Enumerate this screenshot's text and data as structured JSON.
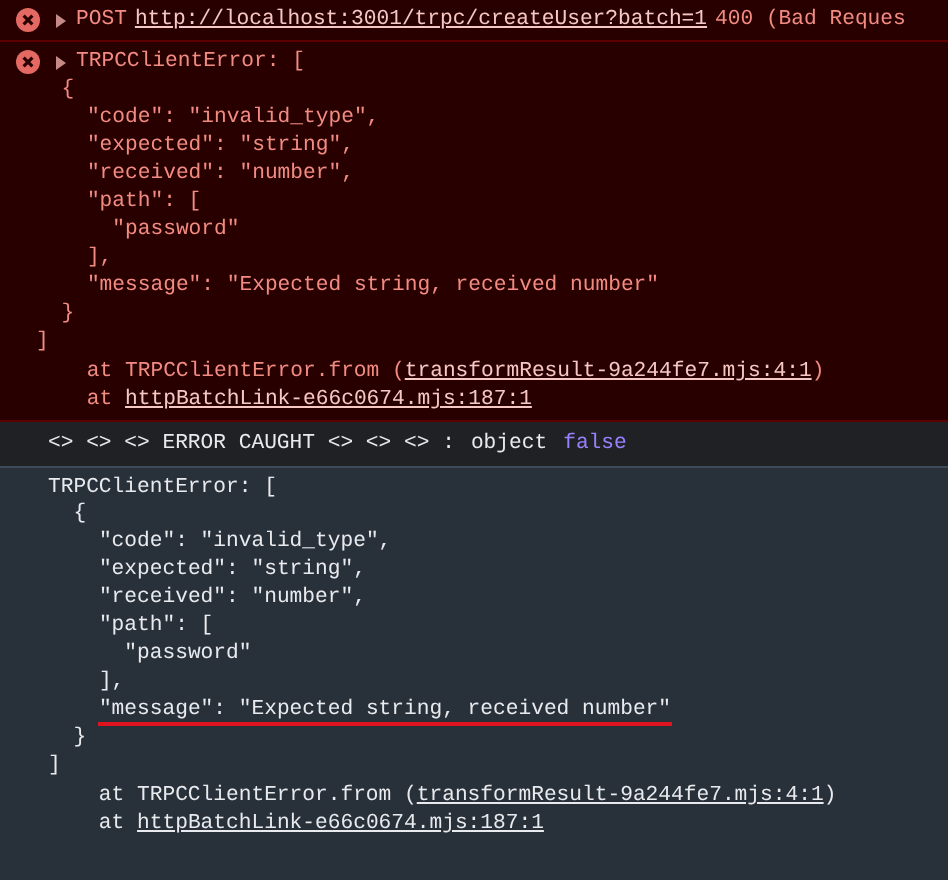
{
  "entries": [
    {
      "kind": "error",
      "expanded": false,
      "method": "POST",
      "url": "http://localhost:3001/trpc/createUser?batch=1",
      "status": "400 (Bad Reques"
    },
    {
      "kind": "error",
      "expanded": false,
      "title": "TRPCClientError: [",
      "lines": [
        {
          "text": "  {",
          "highlighted": false
        },
        {
          "text": "    \"code\": \"invalid_type\",",
          "highlighted": false
        },
        {
          "text": "    \"expected\": \"string\",",
          "highlighted": false
        },
        {
          "text": "    \"received\": \"number\",",
          "highlighted": false
        },
        {
          "text": "    \"path\": [",
          "highlighted": false
        },
        {
          "text": "      \"password\"",
          "highlighted": false
        },
        {
          "text": "    ],",
          "highlighted": false
        },
        {
          "text": "    \"message\": \"Expected string, received number\"",
          "highlighted": false
        },
        {
          "text": "  }",
          "highlighted": false
        },
        {
          "text": "]",
          "highlighted": false
        }
      ],
      "stack": [
        {
          "prefix": "    at TRPCClientError.from (",
          "link": "transformResult-9a244fe7.mjs:4:1",
          "suffix": ")"
        },
        {
          "prefix": "    at ",
          "link": "httpBatchLink-e66c0674.mjs:187:1"
        }
      ]
    },
    {
      "kind": "log",
      "args": [
        {
          "kind": "string",
          "text": "<> <> <> ERROR CAUGHT <> <> <> :"
        },
        {
          "kind": "string",
          "text": "object"
        },
        {
          "kind": "boolean",
          "text": "false"
        }
      ]
    },
    {
      "kind": "plain",
      "title": "TRPCClientError: [",
      "lines": [
        {
          "text": "  {",
          "highlighted": false
        },
        {
          "text": "    \"code\": \"invalid_type\",",
          "highlighted": false
        },
        {
          "text": "    \"expected\": \"string\",",
          "highlighted": false
        },
        {
          "text": "    \"received\": \"number\",",
          "highlighted": false
        },
        {
          "text": "    \"path\": [",
          "highlighted": false
        },
        {
          "text": "      \"password\"",
          "highlighted": false
        },
        {
          "text": "    ],",
          "highlighted": false
        },
        {
          "text": "    \"message\": \"Expected string, received number\"",
          "highlighted": true
        },
        {
          "text": "  }",
          "highlighted": false
        },
        {
          "text": "]",
          "highlighted": false
        }
      ],
      "stack": [
        {
          "prefix": "    at TRPCClientError.from (",
          "link": "transformResult-9a244fe7.mjs:4:1",
          "suffix": ")"
        },
        {
          "prefix": "    at ",
          "link": "httpBatchLink-e66c0674.mjs:187:1"
        }
      ]
    }
  ]
}
